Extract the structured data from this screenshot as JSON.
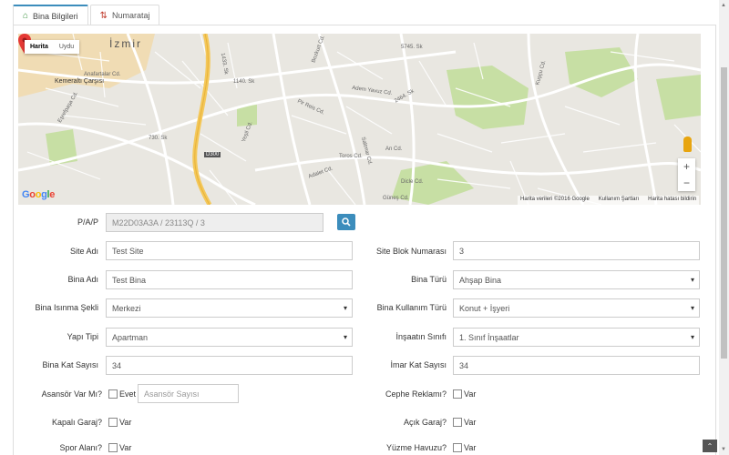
{
  "tabs": [
    {
      "label": "Bina Bilgileri",
      "icon": "home-icon",
      "active": true
    },
    {
      "label": "Numarataj",
      "icon": "sort-icon",
      "active": false
    }
  ],
  "map": {
    "type_buttons": [
      "Harita",
      "Uydu"
    ],
    "city_label": "İzmir",
    "labels": [
      "Kemeraltı Çarşısı",
      "Anafartalar Cd.",
      "Eşrefpaşa Cd.",
      "Pir Reis Cd.",
      "Bozkurt Cd.",
      "Adem Yavuz Cd.",
      "Yeşil Cd.",
      "Toros Cd.",
      "Güneş Cd.",
      "An Cd.",
      "Dicle Cd.",
      "D300",
      "5745. Sk",
      "2464. Sk",
      "730. Sk",
      "1140. Sk",
      "1433. Sk",
      "Saltmar Cd.",
      "Adalet Cd.",
      "Kuşçu Cd."
    ],
    "footer": [
      "Harita verileri ©2016 Google",
      "Kullanım Şartları",
      "Harita hatası bildirin"
    ],
    "google_logo": "Google",
    "zoom_in": "+",
    "zoom_out": "−"
  },
  "form": {
    "pap": {
      "label": "P/A/P",
      "value": "M22D03A3A / 23113Q / 3"
    },
    "site_adi": {
      "label": "Site Adı",
      "value": "Test Site"
    },
    "site_blok": {
      "label": "Site Blok Numarası",
      "value": "3"
    },
    "bina_adi": {
      "label": "Bina Adı",
      "value": "Test Bina"
    },
    "bina_turu": {
      "label": "Bina Türü",
      "value": "Ahşap Bina"
    },
    "isinma": {
      "label": "Bina Isınma Şekli",
      "value": "Merkezi"
    },
    "kullanim": {
      "label": "Bina Kullanım Türü",
      "value": "Konut + İşyeri"
    },
    "yapi_tipi": {
      "label": "Yapı Tipi",
      "value": "Apartman"
    },
    "insaat_sinifi": {
      "label": "İnşaatın Sınıfı",
      "value": "1. Sınıf İnşaatlar"
    },
    "kat_sayisi": {
      "label": "Bina Kat Sayısı",
      "value": "34"
    },
    "imar_kat": {
      "label": "İmar Kat Sayısı",
      "value": "34"
    },
    "asansor": {
      "label": "Asansör Var Mı?",
      "check_label": "Evet",
      "placeholder": "Asansör Sayısı"
    },
    "cephe": {
      "label": "Cephe Reklamı?",
      "check_label": "Var"
    },
    "kapali_garaj": {
      "label": "Kapalı Garaj?",
      "check_label": "Var"
    },
    "acik_garaj": {
      "label": "Açık Garaj?",
      "check_label": "Var"
    },
    "spor": {
      "label": "Spor Alanı?",
      "check_label": "Var"
    },
    "havuz": {
      "label": "Yüzme Havuzu?",
      "check_label": "Var"
    }
  },
  "colors": {
    "accent": "#3c8dbc",
    "home_icon": "#3d9440",
    "sort_icon": "#c0392b",
    "marker": "#e53935"
  }
}
